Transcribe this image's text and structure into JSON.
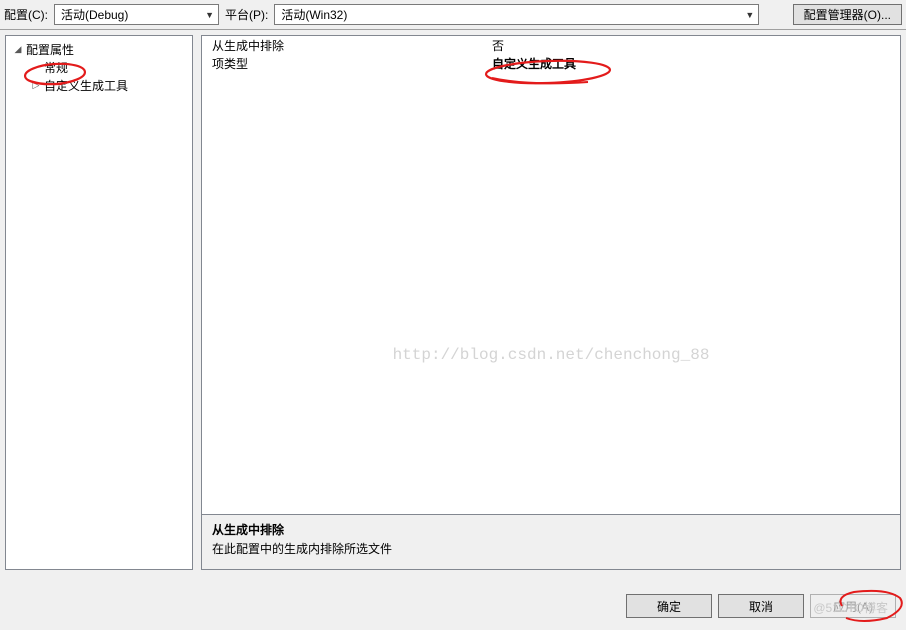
{
  "toolbar": {
    "config_label": "配置(C):",
    "config_value": "活动(Debug)",
    "platform_label": "平台(P):",
    "platform_value": "活动(Win32)",
    "config_mgr_label": "配置管理器(O)..."
  },
  "tree": {
    "root_label": "配置属性",
    "items": [
      {
        "label": "常规"
      },
      {
        "label": "自定义生成工具"
      }
    ]
  },
  "grid": {
    "rows": [
      {
        "label": "从生成中排除",
        "value": "否",
        "bold": false
      },
      {
        "label": "项类型",
        "value": "自定义生成工具",
        "bold": true
      }
    ]
  },
  "description": {
    "title": "从生成中排除",
    "text": "在此配置中的生成内排除所选文件"
  },
  "buttons": {
    "ok": "确定",
    "cancel": "取消",
    "apply": "应用(A)"
  },
  "watermark": "http://blog.csdn.net/chenchong_88",
  "badge": "@51CTO博客"
}
